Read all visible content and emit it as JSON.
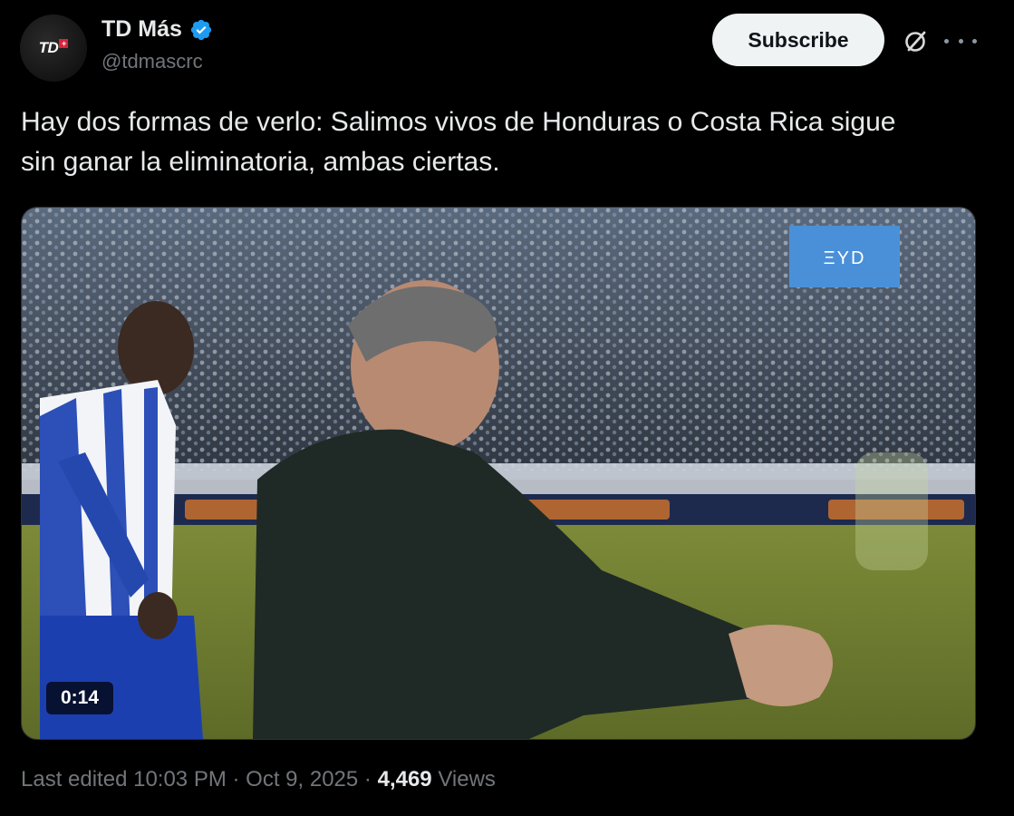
{
  "author": {
    "display_name": "TD Más",
    "handle": "@tdmascrc",
    "avatar_logo": "TD",
    "avatar_logo_plus": "+",
    "verified": true
  },
  "actions": {
    "subscribe_label": "Subscribe",
    "grok_icon": "grok-slash-circle-icon",
    "more_icon": "more-horizontal-icon"
  },
  "tweet": {
    "text": "Hay dos formas de verlo: Salimos vivos de Honduras o Costa Rica sigue\nsin ganar la eliminatoria, ambas ciertas."
  },
  "media": {
    "type": "video",
    "duration": "0:14",
    "sponsor_logo": "ΞYD"
  },
  "meta": {
    "edited_label": "Last edited",
    "time": "10:03 PM",
    "separator": "·",
    "date": "Oct 9, 2025",
    "views_count": "4,469",
    "views_label": "Views"
  },
  "colors": {
    "background": "#000000",
    "text_primary": "#e7e9ea",
    "text_secondary": "#71767b",
    "verified_blue": "#1d9bf0",
    "subscribe_bg": "#eff3f4"
  }
}
